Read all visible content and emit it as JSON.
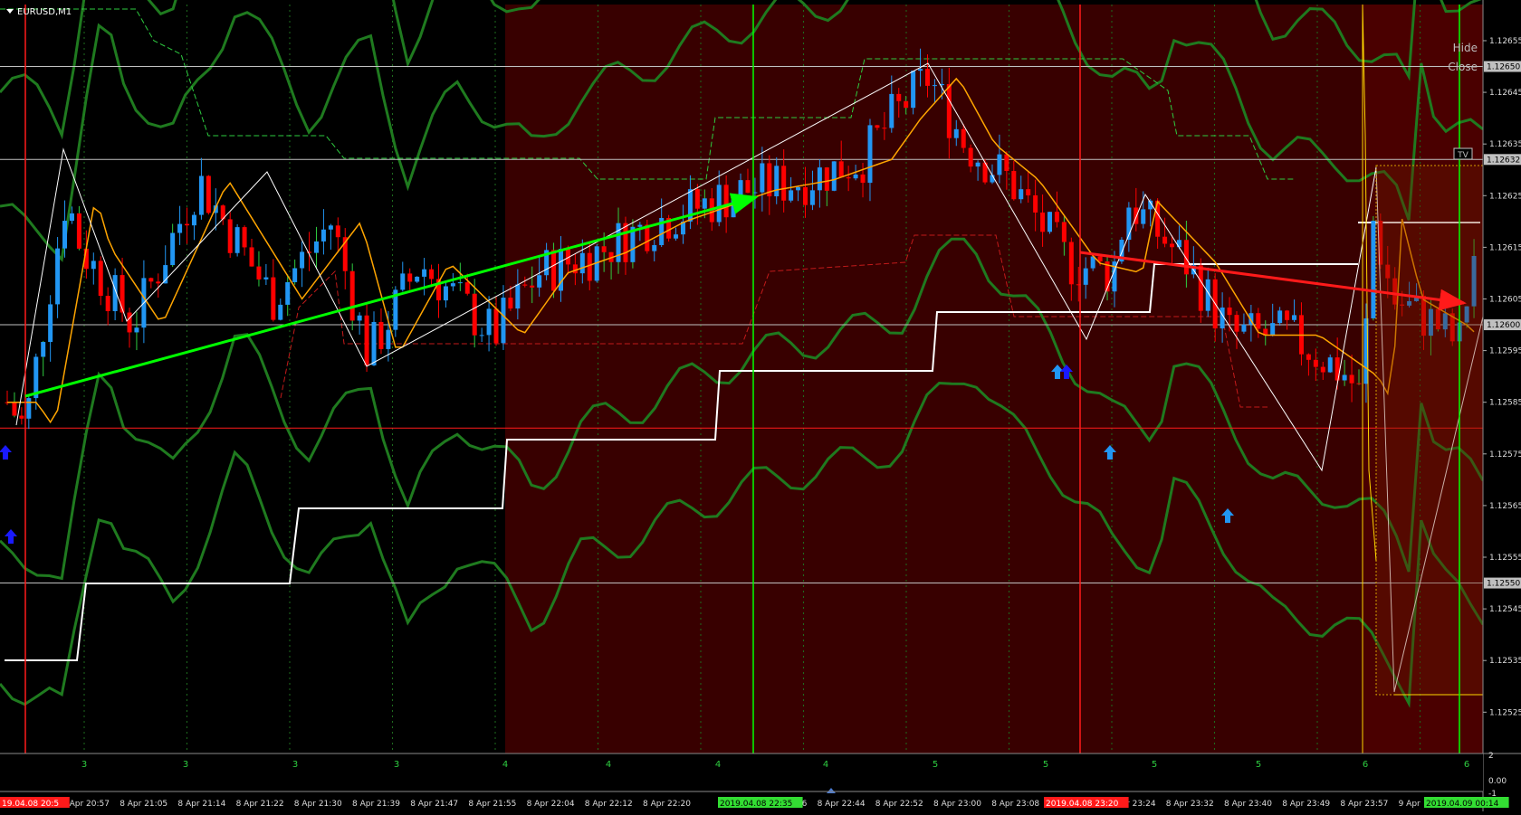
{
  "window": {
    "title": "EURUSD,M1",
    "hide_label": "Hide",
    "close_label": "Close",
    "tv_label": "TV"
  },
  "colors": {
    "background": "#000000",
    "zone_dark_red": "#380000",
    "bull_candle": "#2196f3",
    "bear_candle": "#ff0000",
    "ma_line": "#ffa500",
    "bands": "#1f7a1f",
    "hline": "#c0c0c0",
    "red_line": "#ff1a1a",
    "green_line": "#00ff00",
    "white_step": "#ffffff",
    "sub_label": "#2ecc40",
    "arrow_blue": "#2196f3",
    "arrow_dark_blue": "#1a1aff"
  },
  "chart_data": {
    "type": "line",
    "symbol": "EURUSD",
    "timeframe": "M1",
    "ylim": [
      1.12517,
      1.12662
    ],
    "price_ticks": [
      "1.12655",
      "1.12645",
      "1.12635",
      "1.12625",
      "1.12615",
      "1.12605",
      "1.12595",
      "1.12585",
      "1.12575",
      "1.12565",
      "1.12555",
      "1.12545",
      "1.12535",
      "1.12525"
    ],
    "price_tags": [
      {
        "label": "1.12650",
        "value": 1.1265
      },
      {
        "label": "1.12632",
        "value": 1.12632
      },
      {
        "label": "1.12600",
        "value": 1.126
      },
      {
        "label": "1.12550",
        "value": 1.1255
      }
    ],
    "time_labels": [
      "8 Apr 20:57",
      "8 Apr 21:05",
      "8 Apr 21:14",
      "8 Apr 21:22",
      "8 Apr 21:30",
      "8 Apr 21:39",
      "8 Apr 21:47",
      "8 Apr 21:55",
      "8 Apr 22:04",
      "8 Apr 22:12",
      "8 Apr 22:20",
      "8 Apr 22:36",
      "8 Apr 22:44",
      "8 Apr 22:52",
      "8 Apr 23:00",
      "8 Apr 23:08",
      "8 Apr 23:24",
      "8 Apr 23:32",
      "8 Apr 23:40",
      "8 Apr 23:49",
      "8 Apr 23:57",
      "9 Apr"
    ],
    "marker_labels": {
      "left_red": "19.04.08 20:5",
      "mid_green": "2019.04.08 22:35",
      "mid_red": "2019.04.08 23:20",
      "right_green": "2019.04.09 00:14"
    },
    "sub_window": {
      "counts": [
        "3",
        "3",
        "3",
        "3",
        "4",
        "4",
        "4",
        "4",
        "5",
        "5",
        "5",
        "5",
        "6",
        "6"
      ],
      "axis_labels": [
        "2",
        "0.00",
        "-1"
      ]
    },
    "trend_arrows": [
      {
        "name": "green-trend-arrow",
        "from": [
          0.0,
          1.12583
        ],
        "to": [
          0.5,
          1.12624
        ]
      },
      {
        "name": "red-trend-arrow",
        "from": [
          0.72,
          1.12613
        ],
        "to": [
          0.985,
          1.12603
        ]
      }
    ],
    "grid": true
  }
}
